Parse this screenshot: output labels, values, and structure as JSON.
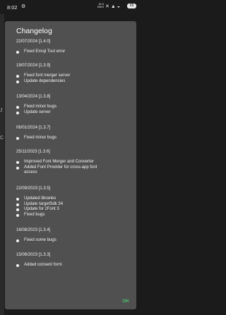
{
  "status_bar": {
    "time": "8:02",
    "netspeed_value": "16.0",
    "netspeed_unit": "KB/S",
    "battery": "69"
  },
  "background": {
    "visible_fragments": [
      "J",
      "C"
    ]
  },
  "dialog": {
    "title": "Changelog",
    "ok_label": "OK",
    "entries": [
      {
        "title": "22/07/2024 [1.4.0]",
        "items": [
          "Fixed Emoji Tool error"
        ]
      },
      {
        "title": "19/07/2024 [1.3.9]",
        "items": [
          "Fixed font merger server",
          "Update dependencies"
        ]
      },
      {
        "title": "13/04/2024 [1.3.8]",
        "items": [
          "Fixed minor bugs",
          "Update server"
        ]
      },
      {
        "title": "06/01/2024 [1.3.7]",
        "items": [
          "Fixed minor bugs"
        ]
      },
      {
        "title": "25/11/2023 [1.3.6]",
        "items": [
          "Improved Font Merger and Converter",
          "Added Font Provider for cross-app font",
          "access"
        ]
      },
      {
        "title": "22/09/2023 [1.3.5]",
        "items": [
          "Updated libraries",
          "Update targetSdk 34",
          "Update for zFont 3",
          "Fixed bugs"
        ]
      },
      {
        "title": "16/08/2023 [1.3.4]",
        "items": [
          "Fixed some bugs"
        ]
      },
      {
        "title": "15/08/2023 [1.3.3]",
        "items": [
          "Added consent form"
        ]
      }
    ]
  }
}
